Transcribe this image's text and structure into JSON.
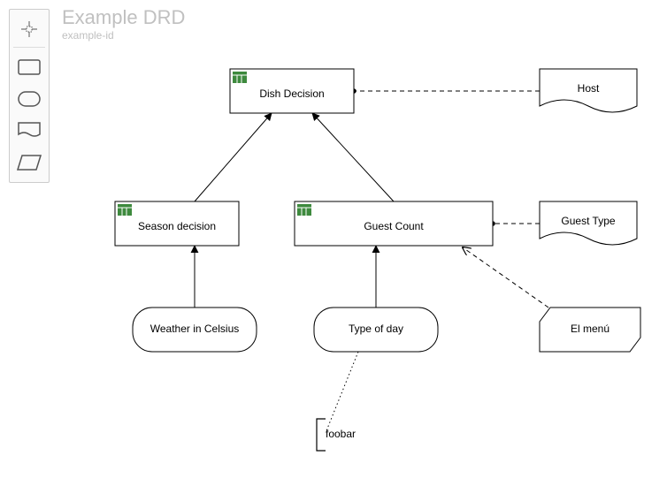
{
  "header": {
    "title": "Example DRD",
    "subtitle": "example-id"
  },
  "palette": {
    "lasso": "lasso-tool",
    "decision": "decision-shape",
    "input": "input-data-shape",
    "knowledge": "knowledge-source-shape",
    "bkm": "business-knowledge-model-shape"
  },
  "nodes": {
    "dish": "Dish Decision",
    "season": "Season decision",
    "guest": "Guest Count",
    "weather": "Weather in Celsius",
    "daytype": "Type of day",
    "host": "Host",
    "guestType": "Guest Type",
    "menu": "El menú",
    "annotation": "foobar"
  },
  "chart_data": {
    "type": "diagram",
    "diagram_type": "DMN-DRD",
    "title": "Example DRD",
    "elements": [
      {
        "id": "dish",
        "type": "decision",
        "label": "Dish Decision",
        "has_decision_table": true
      },
      {
        "id": "season",
        "type": "decision",
        "label": "Season decision",
        "has_decision_table": true
      },
      {
        "id": "guest",
        "type": "decision",
        "label": "Guest Count",
        "has_decision_table": true
      },
      {
        "id": "weather",
        "type": "input-data",
        "label": "Weather in Celsius"
      },
      {
        "id": "daytype",
        "type": "input-data",
        "label": "Type of day"
      },
      {
        "id": "host",
        "type": "knowledge-source",
        "label": "Host"
      },
      {
        "id": "guestType",
        "type": "knowledge-source",
        "label": "Guest Type"
      },
      {
        "id": "menu",
        "type": "business-knowledge-model",
        "label": "El menú"
      },
      {
        "id": "annotation",
        "type": "text-annotation",
        "label": "foobar"
      }
    ],
    "edges": [
      {
        "from": "season",
        "to": "dish",
        "type": "information-requirement"
      },
      {
        "from": "guest",
        "to": "dish",
        "type": "information-requirement"
      },
      {
        "from": "weather",
        "to": "season",
        "type": "information-requirement"
      },
      {
        "from": "daytype",
        "to": "guest",
        "type": "information-requirement"
      },
      {
        "from": "host",
        "to": "dish",
        "type": "authority-requirement"
      },
      {
        "from": "guestType",
        "to": "guest",
        "type": "authority-requirement"
      },
      {
        "from": "menu",
        "to": "guest",
        "type": "knowledge-requirement"
      },
      {
        "from": "daytype",
        "to": "annotation",
        "type": "association"
      }
    ]
  }
}
